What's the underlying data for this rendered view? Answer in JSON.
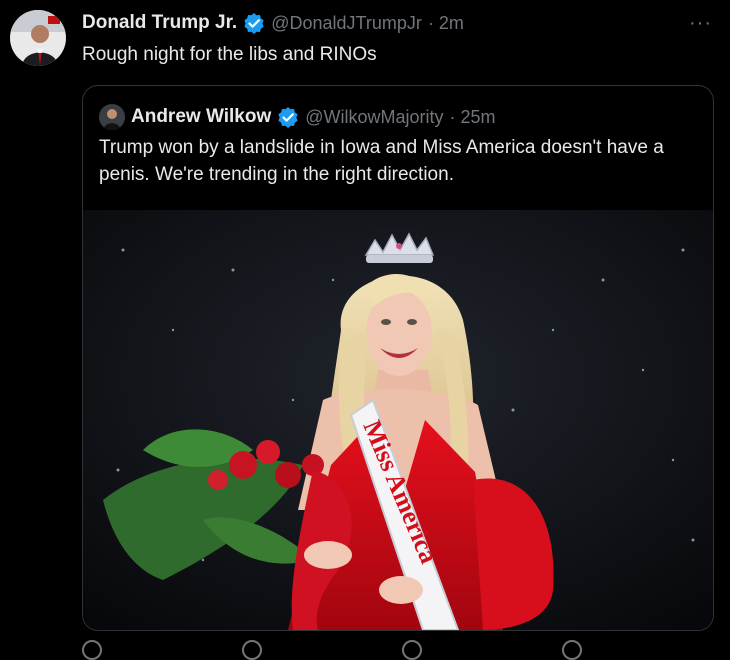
{
  "tweet": {
    "author_name": "Donald Trump Jr.",
    "author_handle": "@DonaldJTrumpJr",
    "time": "· 2m",
    "text": "Rough night for the libs and RINOs",
    "more_label": "···",
    "verified_color": "#1d9bf0"
  },
  "quote": {
    "author_name": "Andrew Wilkow",
    "author_handle": "@WilkowMajority",
    "time": "· 25m",
    "text": "Trump won by a landslide in Iowa and Miss America doesn't have a penis. We're trending in the right direction.",
    "image": {
      "sash_text": "Miss America",
      "icons": [
        "crown-icon",
        "bouquet-icon"
      ]
    }
  },
  "colors": {
    "background": "#000000",
    "text_primary": "#e7e9ea",
    "text_secondary": "#71767b",
    "border": "#2f3336",
    "dress": "#d40d1a"
  }
}
